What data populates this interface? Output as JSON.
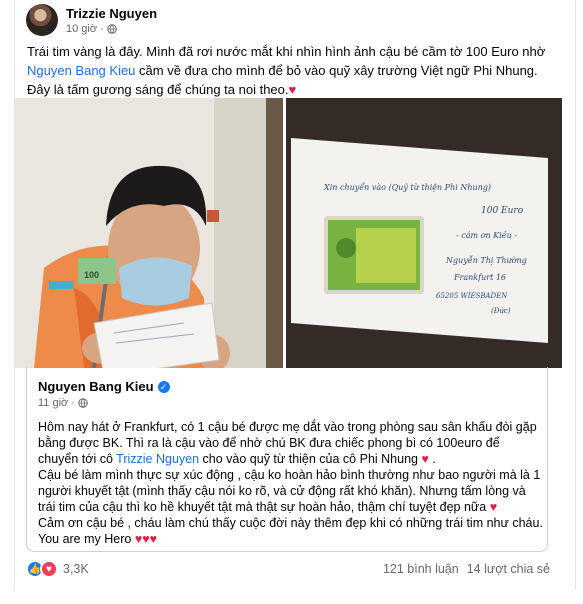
{
  "post": {
    "author": "Trizzie Nguyen",
    "time": "10 giờ",
    "dot": "·",
    "text_before_link": "Trái tim vàng là đây. Mình đã rơi nước mắt khi nhìn hình ảnh cậu bé cầm tờ 100 Euro nhờ ",
    "link_name": "Nguyen Bang Kieu",
    "text_after_link": " cầm về đưa cho mình để bỏ vào quỹ xây trường Việt ngữ Phi Nhung. Đây là tấm gương sáng để chúng ta noi theo.",
    "heart": "♥"
  },
  "photos": {
    "left": {
      "banknote_text": "100"
    },
    "right": {
      "envelope_lines": [
        "Xin chuyển vào (Quỹ từ thiện Phi Nhung)",
        "100 Euro",
        "- cám ơn Kiều -",
        "Nguyễn Thị Thường",
        "Frankfurt 16",
        "65205    WIESBADEN",
        "(Đức)"
      ]
    }
  },
  "shared": {
    "author": "Nguyen Bang Kieu",
    "verified": "✓",
    "time": "11 giờ",
    "dot": "·",
    "p1_before": "Hôm nay hát ở Frankfurt, có 1 cậu bé được mẹ dắt vào trong phòng sau sân khấu đòi gặp bằng được BK. Thì ra là cậu vào để nhờ chú BK đưa chiếc phong bì có 100euro để chuyển tới cô ",
    "p1_link": "Trizzie Nguyen",
    "p1_after": " cho vào quỹ từ thiện của cô Phi Nhung ",
    "p1_end": " .",
    "p2": "Cậu bé làm mình thực sự xúc động , cậu ko hoàn hảo bình thường như bao người mà là 1 người khuyết tật (mình thấy cậu nói ko rõ, và cử động rất khó khăn). Nhưng tấm lòng và trái tim của cậu thì ko hề khuyết tật mà thật sự hoàn hảo, thậm chí tuyệt đẹp nữa ",
    "p3": "Cảm ơn cậu bé , cháu làm chú thấy cuộc đời này thêm đẹp khi có những trái tim như cháu.",
    "p4": "You are my Hero ",
    "hearts_single": "♥",
    "hearts_triple": "♥♥♥"
  },
  "footer": {
    "reaction_count": "3,3K",
    "comments": "121 bình luận",
    "shares": "14 lượt chia sẻ",
    "like_icon": "👍",
    "love_icon": "♥"
  },
  "colors": {
    "link": "#216fdb",
    "heart": "#e41e3f",
    "meta": "#65676b",
    "like": "#1877f2",
    "love": "#f33e58"
  }
}
